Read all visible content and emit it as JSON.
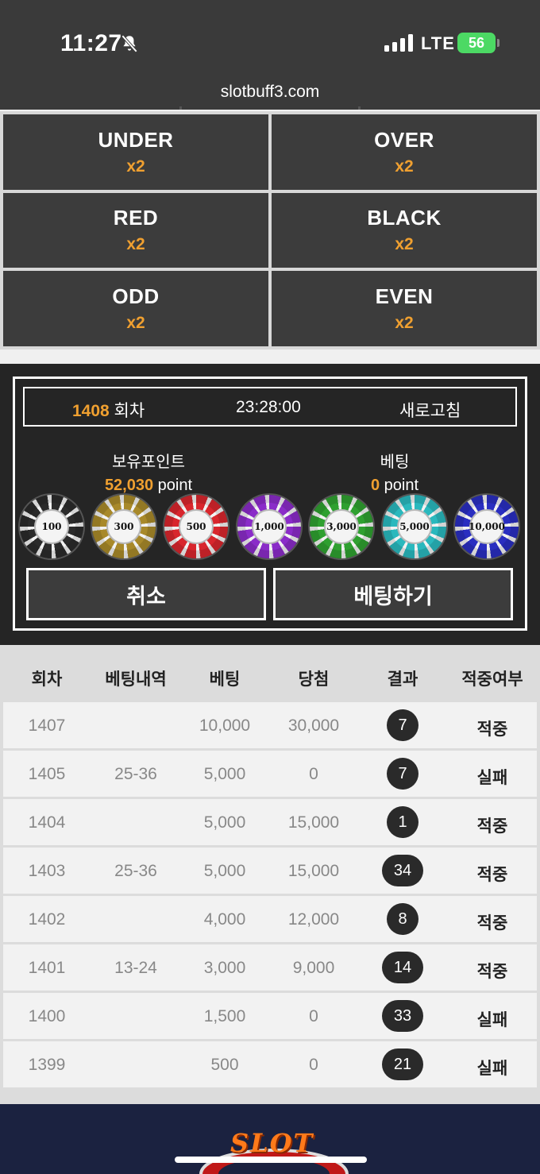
{
  "status": {
    "time": "11:27",
    "network": "LTE",
    "battery": "56"
  },
  "browser": {
    "url": "slotbuff3.com"
  },
  "bets": [
    {
      "name": "UNDER",
      "mult": "x2"
    },
    {
      "name": "OVER",
      "mult": "x2"
    },
    {
      "name": "RED",
      "mult": "x2"
    },
    {
      "name": "BLACK",
      "mult": "x2"
    },
    {
      "name": "ODD",
      "mult": "x2"
    },
    {
      "name": "EVEN",
      "mult": "x2"
    }
  ],
  "round": {
    "number": "1408",
    "suffix": " 회차",
    "timer": "23:28:00",
    "refresh": "새로고침"
  },
  "points": {
    "holding_label": "보유포인트",
    "holding_value": "52,030",
    "holding_unit": " point",
    "bet_label": "베팅",
    "bet_value": "0",
    "bet_unit": " point"
  },
  "chips": [
    {
      "label": "100",
      "color": "#2b2b2b"
    },
    {
      "label": "300",
      "color": "#a8892a"
    },
    {
      "label": "500",
      "color": "#d8262d"
    },
    {
      "label": "1,000",
      "color": "#8a2cc8"
    },
    {
      "label": "3,000",
      "color": "#2fa030"
    },
    {
      "label": "5,000",
      "color": "#2ab8bd"
    },
    {
      "label": "10,000",
      "color": "#2a2ec0"
    }
  ],
  "actions": {
    "cancel": "취소",
    "bet": "베팅하기"
  },
  "history": {
    "headers": [
      "회차",
      "베팅내역",
      "베팅",
      "당첨",
      "결과",
      "적중여부"
    ],
    "rows": [
      {
        "round": "1407",
        "detail": "",
        "bet": "10,000",
        "win": "30,000",
        "result": "7",
        "outcome": "적중"
      },
      {
        "round": "1405",
        "detail": "25-36",
        "bet": "5,000",
        "win": "0",
        "result": "7",
        "outcome": "실패"
      },
      {
        "round": "1404",
        "detail": "",
        "bet": "5,000",
        "win": "15,000",
        "result": "1",
        "outcome": "적중"
      },
      {
        "round": "1403",
        "detail": "25-36",
        "bet": "5,000",
        "win": "15,000",
        "result": "34",
        "outcome": "적중"
      },
      {
        "round": "1402",
        "detail": "",
        "bet": "4,000",
        "win": "12,000",
        "result": "8",
        "outcome": "적중"
      },
      {
        "round": "1401",
        "detail": "13-24",
        "bet": "3,000",
        "win": "9,000",
        "result": "14",
        "outcome": "적중"
      },
      {
        "round": "1400",
        "detail": "",
        "bet": "1,500",
        "win": "0",
        "result": "33",
        "outcome": "실패"
      },
      {
        "round": "1399",
        "detail": "",
        "bet": "500",
        "win": "0",
        "result": "21",
        "outcome": "실패"
      }
    ]
  },
  "footer": {
    "logo_text": "SLOT"
  }
}
